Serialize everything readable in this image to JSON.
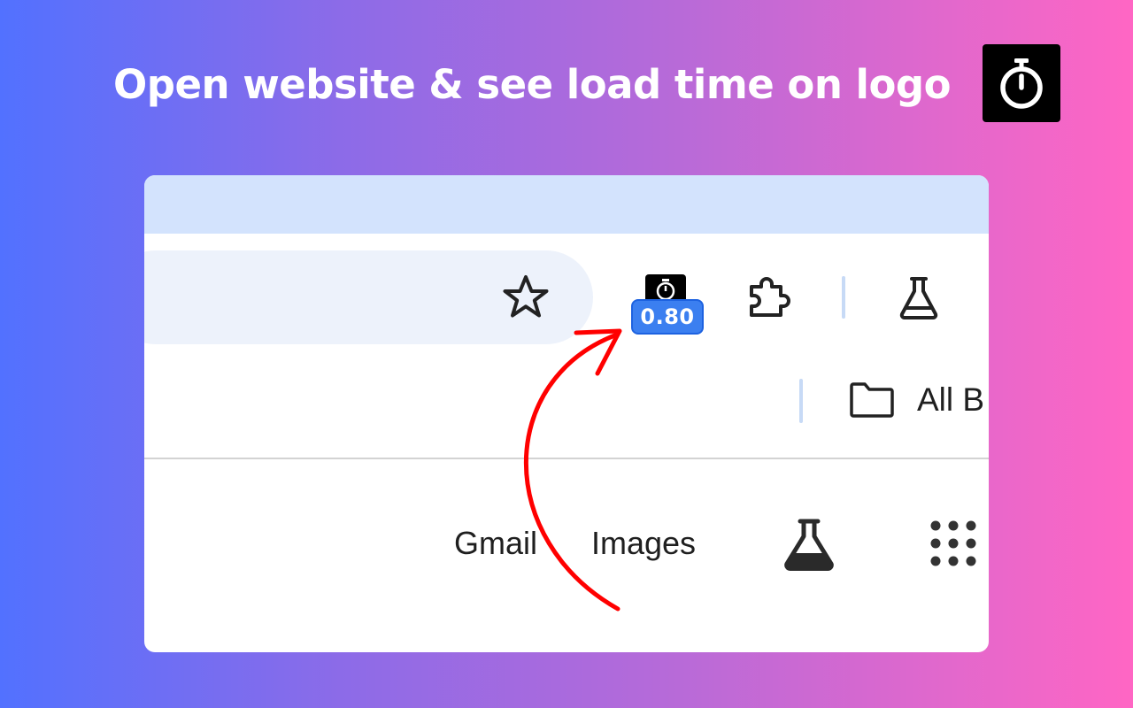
{
  "headline": "Open website & see load time on logo",
  "app_logo_icon": "stopwatch-icon",
  "toolbar": {
    "bookmark_icon": "star-icon",
    "extension": {
      "icon": "stopwatch-icon",
      "badge": "0.80",
      "badge_color": "#3b7ff0"
    },
    "extensions_menu_icon": "puzzle-icon",
    "labs_icon": "flask-icon"
  },
  "bookmarks_bar": {
    "folder_icon": "folder-icon",
    "label": "All B"
  },
  "google_header": {
    "gmail": "Gmail",
    "images": "Images",
    "labs_icon": "flask-icon",
    "apps_icon": "apps-grid-icon"
  },
  "annotation": {
    "arrow_color": "#ff0000"
  }
}
